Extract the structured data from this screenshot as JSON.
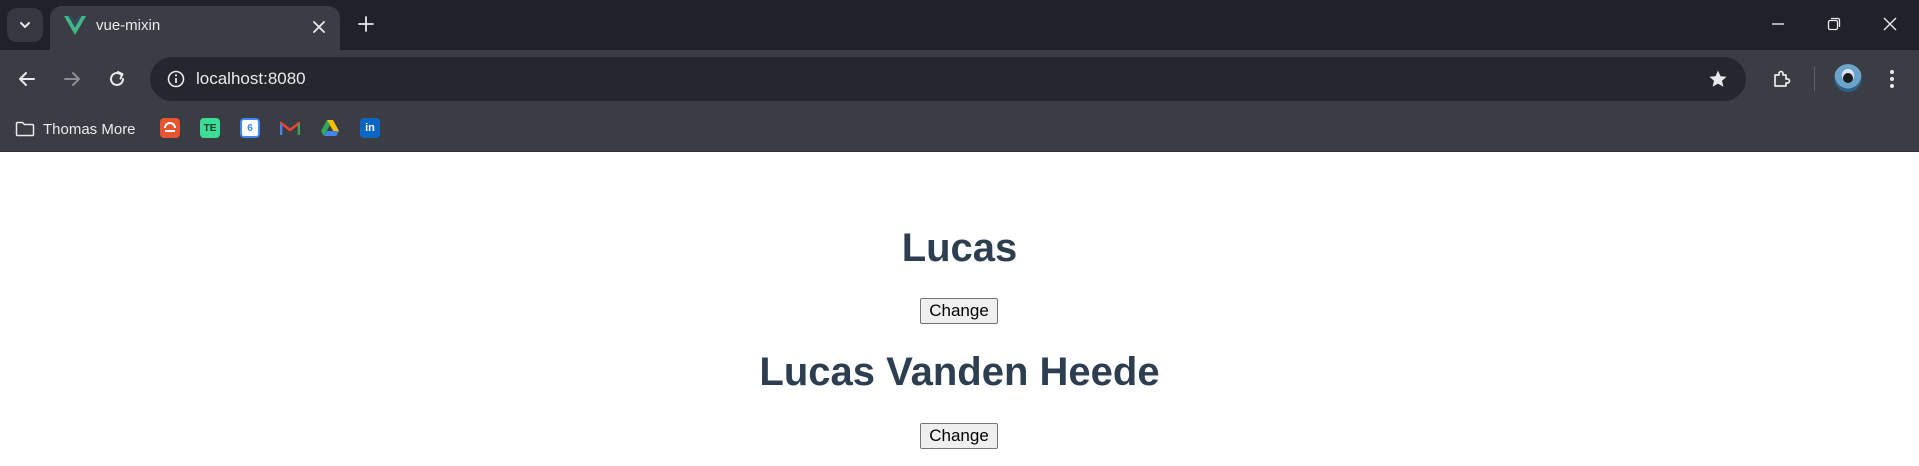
{
  "browser": {
    "tab": {
      "title": "vue-mixin",
      "favicon": "vue-logo-icon"
    },
    "omnibox": {
      "url": "localhost:8080"
    },
    "bookmarks": {
      "folder_label": "Thomas More",
      "items": [
        {
          "icon": "bookmark-orange-icon",
          "text": "",
          "color": "#e8542f"
        },
        {
          "icon": "bookmark-te-icon",
          "text": "TE",
          "color": "#3ddc97"
        },
        {
          "icon": "google-calendar-icon",
          "text": "6",
          "color": "#4285f4"
        },
        {
          "icon": "gmail-icon",
          "text": "M",
          "color": "#ea4335"
        },
        {
          "icon": "google-drive-icon",
          "text": "",
          "color": "#fbbc04"
        },
        {
          "icon": "linkedin-icon",
          "text": "in",
          "color": "#0a66c2"
        }
      ]
    },
    "colors": {
      "tabstrip": "#1f2228",
      "toolbar": "#3a3d44",
      "omnibox": "#24272d",
      "text": "#e8eaed"
    }
  },
  "page": {
    "first_name": "Lucas",
    "first_button": "Change",
    "full_name": "Lucas Vanden Heede",
    "second_button": "Change",
    "heading_color": "#2c3e50"
  }
}
